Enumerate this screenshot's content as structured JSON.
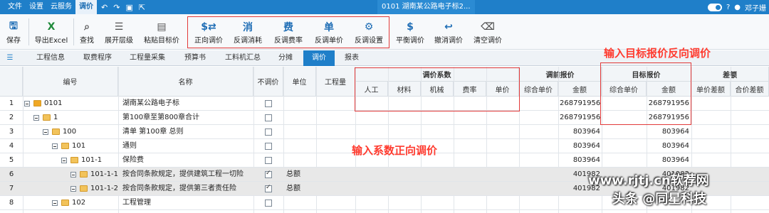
{
  "titlebar": {
    "menus": [
      "文件",
      "设置",
      "云服务",
      "调价"
    ],
    "active_menu": "调价",
    "document": "0101  湖南某公路电子标2...",
    "user": "邓子姗"
  },
  "ribbon": {
    "buttons": [
      {
        "label": "保存",
        "icon": "save-icon"
      },
      {
        "label": "导出Excel",
        "icon": "excel-icon"
      },
      {
        "label": "查找",
        "icon": "search-icon"
      },
      {
        "label": "展开层级",
        "icon": "expand-icon"
      },
      {
        "label": "粘贴目标价",
        "icon": "paste-icon"
      },
      {
        "label": "正向调价",
        "icon": "forward-adjust-icon"
      },
      {
        "label": "反调消耗",
        "icon": "reverse-consume-icon"
      },
      {
        "label": "反调费率",
        "icon": "reverse-rate-icon"
      },
      {
        "label": "反调单价",
        "icon": "reverse-price-icon"
      },
      {
        "label": "反调设置",
        "icon": "reverse-settings-icon"
      },
      {
        "label": "平衡调价",
        "icon": "balance-icon"
      },
      {
        "label": "撤消调价",
        "icon": "undo-icon"
      },
      {
        "label": "清空调价",
        "icon": "clear-icon"
      }
    ]
  },
  "tabs": [
    "工程信息",
    "取费程序",
    "工程量采集",
    "预算书",
    "工料机汇总",
    "分摊",
    "调价",
    "报表"
  ],
  "active_tab": "调价",
  "headers": {
    "code": "编号",
    "name": "名称",
    "noadjust": "不调价",
    "unit": "单位",
    "qty": "工程量",
    "coef_group": "调价系数",
    "coef": [
      "人工",
      "材料",
      "机械",
      "费率",
      "单价"
    ],
    "pre_group": "调前报价",
    "pre": [
      "综合单价",
      "金额"
    ],
    "target_group": "目标报价",
    "target": [
      "综合单价",
      "金额"
    ],
    "diff_group": "差额",
    "diff": [
      "单价差额",
      "合价差额"
    ]
  },
  "rows": [
    {
      "num": "1",
      "code": "0101",
      "name": "湖南某公路电子标",
      "noadjust": false,
      "unit": "",
      "pre_amount": "268791956",
      "target_amount": "268791956",
      "level": 0,
      "icon": "root"
    },
    {
      "num": "2",
      "code": "1",
      "name": "第100章至第800章合计",
      "noadjust": false,
      "unit": "",
      "pre_amount": "268791956",
      "target_amount": "268791956",
      "level": 1,
      "icon": "folder"
    },
    {
      "num": "3",
      "code": "100",
      "name": "清单 第100章 总则",
      "noadjust": false,
      "unit": "",
      "pre_amount": "803964",
      "target_amount": "803964",
      "level": 2,
      "icon": "folder"
    },
    {
      "num": "4",
      "code": "101",
      "name": "通则",
      "noadjust": false,
      "unit": "",
      "pre_amount": "803964",
      "target_amount": "803964",
      "level": 3,
      "icon": "folder"
    },
    {
      "num": "5",
      "code": "101-1",
      "name": "保险费",
      "noadjust": false,
      "unit": "",
      "pre_amount": "803964",
      "target_amount": "803964",
      "level": 4,
      "icon": "folder"
    },
    {
      "num": "6",
      "code": "101-1-1",
      "name": "按合同条款规定，提供建筑工程一切险",
      "noadjust": true,
      "unit": "总额",
      "pre_amount": "401982",
      "target_amount": "401982",
      "level": 5,
      "icon": "folder",
      "gray": true
    },
    {
      "num": "7",
      "code": "101-1-2",
      "name": "按合同条款规定，提供第三者责任险",
      "noadjust": true,
      "unit": "总额",
      "pre_amount": "401982",
      "target_amount": "401982",
      "level": 5,
      "icon": "folder",
      "gray": true
    },
    {
      "num": "8",
      "code": "102",
      "name": "工程管理",
      "noadjust": false,
      "unit": "",
      "pre_amount": "",
      "target_amount": "",
      "level": 3,
      "icon": "folder"
    }
  ],
  "annotations": {
    "reverse": "输入目标报价反向调价",
    "forward": "输入系数正向调价"
  },
  "watermark": {
    "site": "www.rjtj.cn软荐网",
    "brand": "头条 @同星科技"
  }
}
